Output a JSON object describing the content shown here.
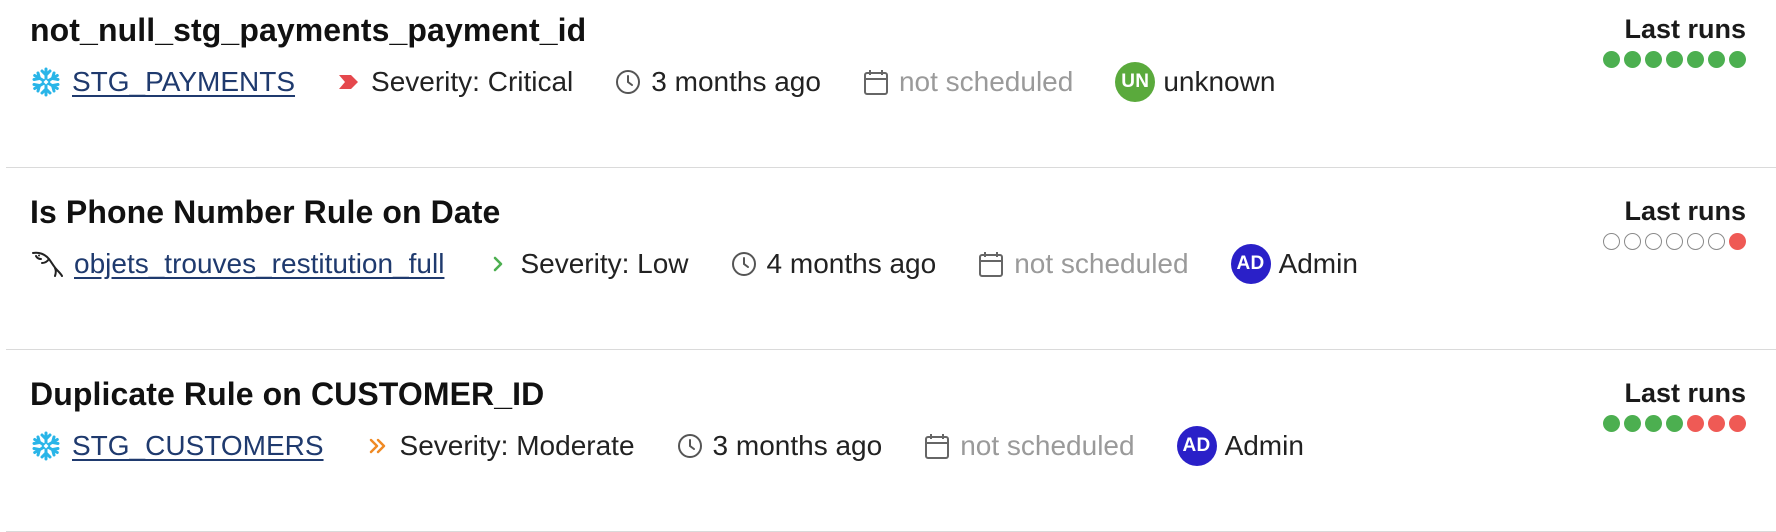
{
  "colors": {
    "pass": "#4caf50",
    "fail": "#ef5a55",
    "link": "#1f3a6e",
    "severity_critical": "#e5484d",
    "severity_low": "#4caf50",
    "severity_moderate": "#f08a24"
  },
  "rules": [
    {
      "title": "not_null_stg_payments_payment_id",
      "source_icon": "snowflake-icon",
      "source": "STG_PAYMENTS",
      "severity_icon": "severity-critical-icon",
      "severity": "Severity: Critical",
      "updated": "3 months ago",
      "schedule": "not scheduled",
      "owner_initials": "UN",
      "owner_color": "#5aaa3c",
      "owner": "unknown",
      "runs_label": "Last runs",
      "runs": [
        "pass",
        "pass",
        "pass",
        "pass",
        "pass",
        "pass",
        "pass"
      ]
    },
    {
      "title": "Is Phone Number Rule on Date",
      "source_icon": "mysql-dolphin-icon",
      "source": "objets_trouves_restitution_full",
      "severity_icon": "severity-low-icon",
      "severity": "Severity: Low",
      "updated": "4 months ago",
      "schedule": "not scheduled",
      "owner_initials": "AD",
      "owner_color": "#2a20c8",
      "owner": "Admin",
      "runs_label": "Last runs",
      "runs": [
        "empty",
        "empty",
        "empty",
        "empty",
        "empty",
        "empty",
        "fail"
      ]
    },
    {
      "title": "Duplicate Rule on CUSTOMER_ID",
      "source_icon": "snowflake-icon",
      "source": "STG_CUSTOMERS",
      "severity_icon": "severity-moderate-icon",
      "severity": "Severity: Moderate",
      "updated": "3 months ago",
      "schedule": "not scheduled",
      "owner_initials": "AD",
      "owner_color": "#2a20c8",
      "owner": "Admin",
      "runs_label": "Last runs",
      "runs": [
        "pass",
        "pass",
        "pass",
        "pass",
        "fail",
        "fail",
        "fail"
      ]
    }
  ]
}
